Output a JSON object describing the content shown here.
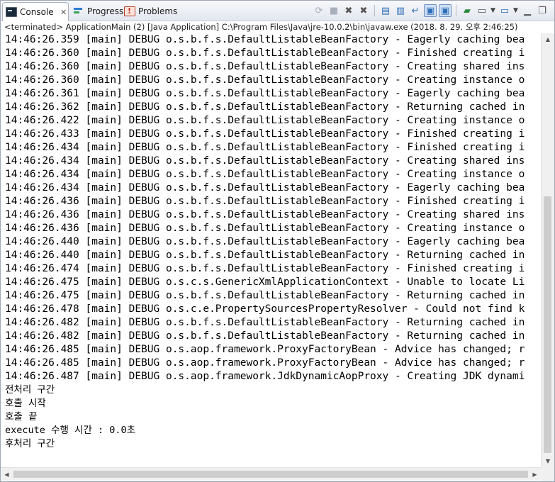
{
  "tabs": {
    "console": {
      "label": "Console",
      "close": "✕"
    },
    "progress": {
      "label": "Progress"
    },
    "problems": {
      "label": "Problems"
    }
  },
  "toolbar": {
    "icons": [
      "sync-icon",
      "terminate-icon",
      "remove-launch-icon",
      "remove-all-terminated-icon",
      "clear-console-icon",
      "scroll-lock-icon",
      "word-wrap-icon",
      "show-on-stdout-icon",
      "show-on-stderr-icon",
      "pin-console-icon",
      "display-console-icon",
      "open-console-icon",
      "minimize-icon",
      "maximize-icon"
    ]
  },
  "status": "<terminated> ApplicationMain (2) [Java Application] C:\\Program Files\\Java\\jre-10.0.2\\bin\\javaw.exe (2018. 8. 29. 오후 2:46:25)",
  "log_lines": [
    "14:46:26.359 [main] DEBUG o.s.b.f.s.DefaultListableBeanFactory - Eagerly caching bea",
    "14:46:26.360 [main] DEBUG o.s.b.f.s.DefaultListableBeanFactory - Finished creating i",
    "14:46:26.360 [main] DEBUG o.s.b.f.s.DefaultListableBeanFactory - Creating shared ins",
    "14:46:26.360 [main] DEBUG o.s.b.f.s.DefaultListableBeanFactory - Creating instance o",
    "14:46:26.361 [main] DEBUG o.s.b.f.s.DefaultListableBeanFactory - Eagerly caching bea",
    "14:46:26.362 [main] DEBUG o.s.b.f.s.DefaultListableBeanFactory - Returning cached in",
    "14:46:26.422 [main] DEBUG o.s.b.f.s.DefaultListableBeanFactory - Creating instance o",
    "14:46:26.433 [main] DEBUG o.s.b.f.s.DefaultListableBeanFactory - Finished creating i",
    "14:46:26.434 [main] DEBUG o.s.b.f.s.DefaultListableBeanFactory - Finished creating i",
    "14:46:26.434 [main] DEBUG o.s.b.f.s.DefaultListableBeanFactory - Creating shared ins",
    "14:46:26.434 [main] DEBUG o.s.b.f.s.DefaultListableBeanFactory - Creating instance o",
    "14:46:26.434 [main] DEBUG o.s.b.f.s.DefaultListableBeanFactory - Eagerly caching bea",
    "14:46:26.436 [main] DEBUG o.s.b.f.s.DefaultListableBeanFactory - Finished creating i",
    "14:46:26.436 [main] DEBUG o.s.b.f.s.DefaultListableBeanFactory - Creating shared ins",
    "14:46:26.436 [main] DEBUG o.s.b.f.s.DefaultListableBeanFactory - Creating instance o",
    "14:46:26.440 [main] DEBUG o.s.b.f.s.DefaultListableBeanFactory - Eagerly caching bea",
    "14:46:26.440 [main] DEBUG o.s.b.f.s.DefaultListableBeanFactory - Returning cached in",
    "14:46:26.474 [main] DEBUG o.s.b.f.s.DefaultListableBeanFactory - Finished creating i",
    "14:46:26.475 [main] DEBUG o.s.c.s.GenericXmlApplicationContext - Unable to locate Li",
    "14:46:26.475 [main] DEBUG o.s.b.f.s.DefaultListableBeanFactory - Returning cached in",
    "14:46:26.478 [main] DEBUG o.s.c.e.PropertySourcesPropertyResolver - Could not find k",
    "14:46:26.482 [main] DEBUG o.s.b.f.s.DefaultListableBeanFactory - Returning cached in",
    "14:46:26.482 [main] DEBUG o.s.b.f.s.DefaultListableBeanFactory - Returning cached in",
    "14:46:26.485 [main] DEBUG o.s.aop.framework.ProxyFactoryBean - Advice has changed; r",
    "14:46:26.485 [main] DEBUG o.s.aop.framework.ProxyFactoryBean - Advice has changed; r",
    "14:46:26.487 [main] DEBUG o.s.aop.framework.JdkDynamicAopProxy - Creating JDK dynami"
  ],
  "output_lines": [
    "전처리 구간",
    "호출 시작",
    "호출 끝",
    "execute 수행 시간 : 0.0초",
    "후처리 구간"
  ]
}
